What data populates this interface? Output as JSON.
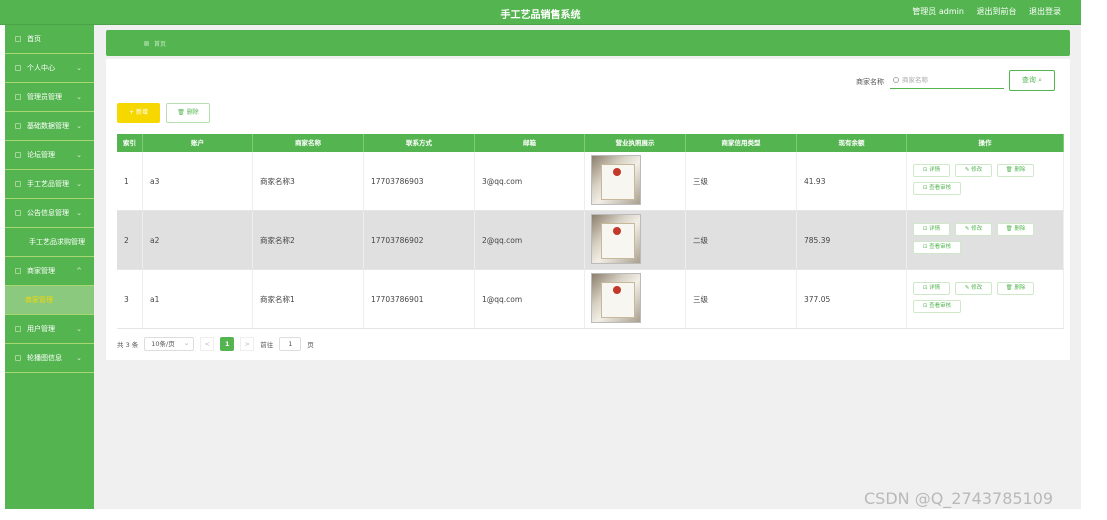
{
  "header": {
    "title": "手工艺品销售系统",
    "admin_label": "管理员 admin",
    "front_link": "退出到前台",
    "logout_link": "退出登录"
  },
  "sidebar": {
    "items": [
      {
        "label": "首页"
      },
      {
        "label": "个人中心"
      },
      {
        "label": "管理员管理"
      },
      {
        "label": "基础数据管理"
      },
      {
        "label": "论坛管理"
      },
      {
        "label": "手工艺品管理"
      },
      {
        "label": "公告信息管理"
      },
      {
        "label": "手工艺品求购管理"
      },
      {
        "label": "商家管理"
      },
      {
        "label": "商家管理"
      },
      {
        "label": "用户管理"
      },
      {
        "label": "轮播图信息"
      }
    ]
  },
  "breadcrumb": {
    "current": "首页"
  },
  "search": {
    "label": "商家名称",
    "placeholder": "商家名称",
    "button": "查询"
  },
  "toolbar": {
    "add_label": "+ 新增",
    "delete_label": "删除"
  },
  "table": {
    "headers": [
      "索引",
      "账户",
      "商家名称",
      "联系方式",
      "邮箱",
      "营业执照展示",
      "商家信用类型",
      "现有余额",
      "操作"
    ],
    "rows": [
      {
        "index": "1",
        "account": "a3",
        "name": "商家名称3",
        "phone": "17703786903",
        "email": "3@qq.com",
        "credit": "三级",
        "balance": "41.93"
      },
      {
        "index": "2",
        "account": "a2",
        "name": "商家名称2",
        "phone": "17703786902",
        "email": "2@qq.com",
        "credit": "二级",
        "balance": "785.39"
      },
      {
        "index": "3",
        "account": "a1",
        "name": "商家名称1",
        "phone": "17703786901",
        "email": "1@qq.com",
        "credit": "三级",
        "balance": "377.05"
      }
    ],
    "actions": {
      "detail": "详情",
      "edit": "修改",
      "delete": "删除",
      "review": "查看审核"
    }
  },
  "pagination": {
    "total": "共 3 条",
    "page_size": "10条/页",
    "prev": "<",
    "current": "1",
    "next": ">",
    "goto_label": "前往",
    "goto_value": "1",
    "page_suffix": "页"
  },
  "watermark": "CSDN @Q_2743785109",
  "colors": {
    "primary": "#54b550",
    "accent": "#f6d800"
  }
}
